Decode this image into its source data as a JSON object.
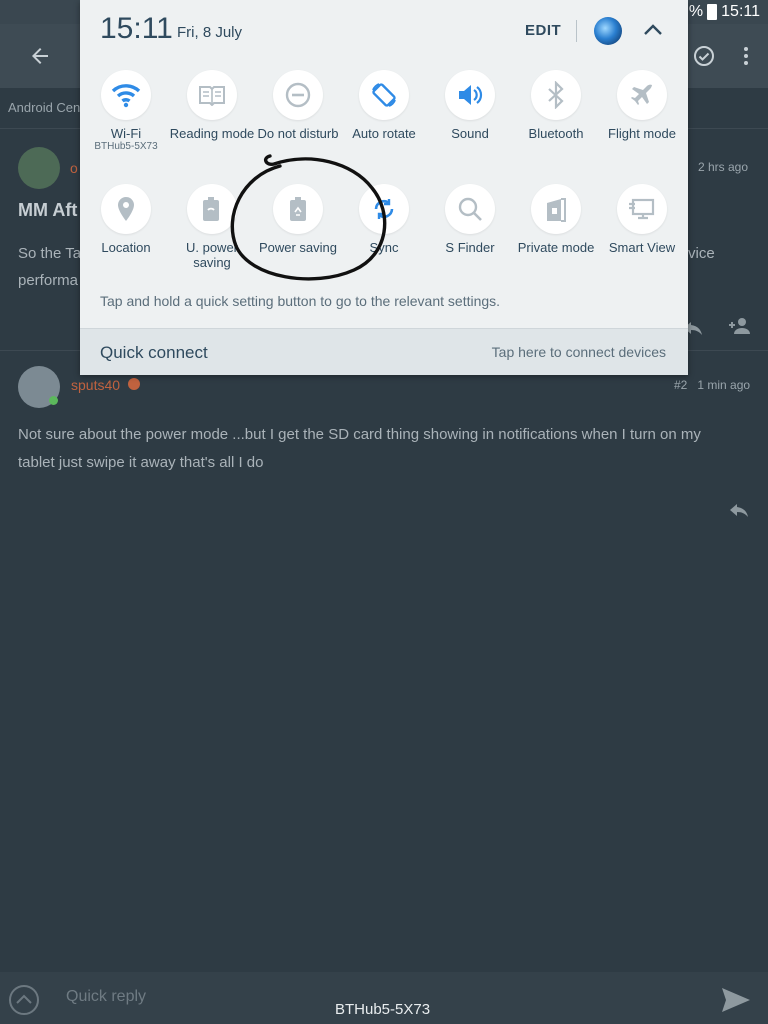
{
  "status_bar": {
    "battery": "%",
    "time": "15:11"
  },
  "background": {
    "crumb": "Android Cen",
    "post1": {
      "author_fragment": "o",
      "time": "2 hrs ago",
      "title_fragment": "MM Aft",
      "body_line1_start": "So the Ta",
      "body_line1_end": "vice",
      "body_line2": "performa"
    },
    "post2": {
      "author": "sputs40",
      "meta": "#2   1 min ago",
      "body": "Not sure about the power mode ...but I get the SD card thing showing in notifications when I turn on my tablet just swipe it away that's all I do"
    },
    "quick_reply_placeholder": "Quick reply",
    "toast": "BTHub5-5X73"
  },
  "quick_panel": {
    "time": "15:11",
    "date": "Fri, 8 July",
    "edit_label": "EDIT",
    "hint": "Tap and hold a quick setting button to go to the relevant settings.",
    "tiles_row1": [
      {
        "label": "Wi-Fi",
        "sub": "BTHub5-5X73",
        "icon": "wifi-icon"
      },
      {
        "label": "Reading mode",
        "icon": "book-icon"
      },
      {
        "label": "Do not disturb",
        "icon": "minus-circle-icon"
      },
      {
        "label": "Auto rotate",
        "icon": "rotate-icon"
      },
      {
        "label": "Sound",
        "icon": "speaker-icon"
      },
      {
        "label": "Bluetooth",
        "icon": "bluetooth-icon"
      },
      {
        "label": "Flight mode",
        "icon": "airplane-icon"
      }
    ],
    "tiles_row2": [
      {
        "label": "Location",
        "icon": "location-pin-icon"
      },
      {
        "label": "U. power saving",
        "icon": "ultra-power-saving-icon"
      },
      {
        "label": "Power saving",
        "icon": "battery-recycle-icon"
      },
      {
        "label": "Sync",
        "icon": "sync-icon"
      },
      {
        "label": "S Finder",
        "icon": "search-icon"
      },
      {
        "label": "Private mode",
        "icon": "private-mode-icon"
      },
      {
        "label": "Smart View",
        "icon": "smart-view-icon"
      }
    ],
    "quick_connect_title": "Quick connect",
    "quick_connect_hint": "Tap here to connect devices"
  },
  "colors": {
    "active_blue": "#2f8be6",
    "inactive_grey": "#b4bec5",
    "panel_bg": "#eef1f2",
    "app_bg": "#2e3b44"
  }
}
